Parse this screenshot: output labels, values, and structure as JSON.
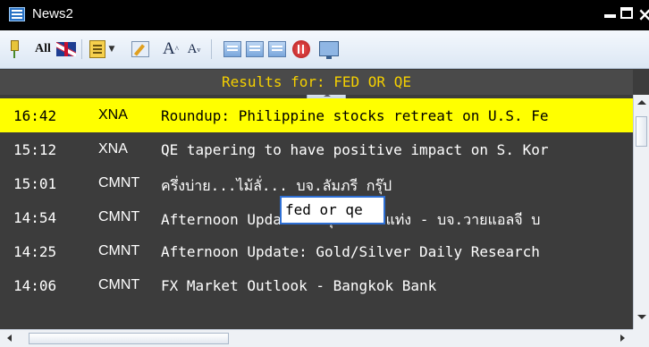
{
  "window": {
    "title": "News2"
  },
  "toolbar": {
    "all_label": "All"
  },
  "results": {
    "header": "Results for: FED OR QE"
  },
  "search_popup": {
    "value": "fed or qe"
  },
  "news_rows": [
    {
      "time": "16:42",
      "source": "XNA",
      "headline": "Roundup: Philippine stocks retreat on U.S. Fe",
      "selected": true
    },
    {
      "time": "15:12",
      "source": "XNA",
      "headline": "QE tapering to have positive impact on S. Kor",
      "selected": false
    },
    {
      "time": "15:01",
      "source": "CMNT",
      "headline": "ครึ่งบ่าย...ไม้ลั่... บจ.ลัมภรี กรุ๊ป",
      "selected": false
    },
    {
      "time": "14:54",
      "source": "CMNT",
      "headline": "Afternoon Update: สถุนทองคำแท่ง - บจ.วายแอลจี บ",
      "selected": false
    },
    {
      "time": "14:25",
      "source": "CMNT",
      "headline": "Afternoon Update: Gold/Silver Daily Research",
      "selected": false
    },
    {
      "time": "14:06",
      "source": "CMNT",
      "headline": "FX Market Outlook - Bangkok Bank",
      "selected": false
    },
    {
      "time": "",
      "source": "",
      "headline": "",
      "selected": false
    }
  ]
}
